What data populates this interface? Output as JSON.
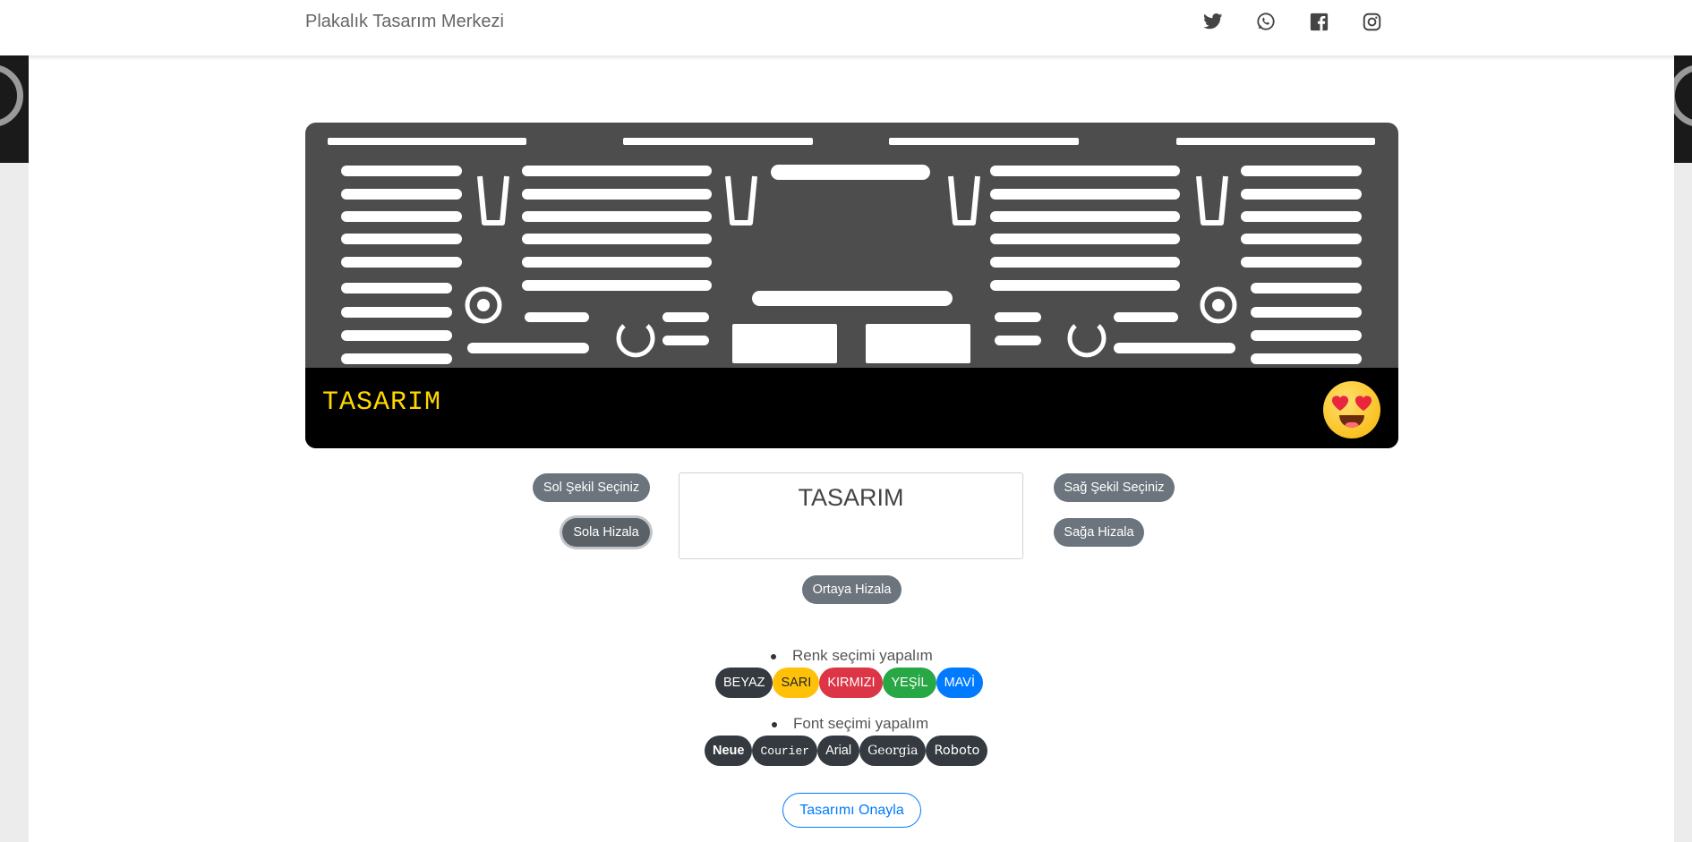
{
  "nav": {
    "brand": "Plakalık Tasarım Merkezi",
    "social": [
      "twitter-icon",
      "whatsapp-icon",
      "facebook-icon",
      "instagram-icon"
    ]
  },
  "plate": {
    "text": "TASARIM",
    "text_color": "#ffd700",
    "frame_color": "#4d4d4d",
    "strip_color": "#000000",
    "right_shape": "heart-eyes-emoji"
  },
  "controls": {
    "left_shape_label": "Sol Şekil Seçiniz",
    "right_shape_label": "Sağ Şekil Seçiniz",
    "align_left_label": "Sola Hizala",
    "align_right_label": "Sağa Hizala",
    "align_center_label": "Ortaya Hizala",
    "text_value": "TASARIM"
  },
  "colors": {
    "title": "Renk seçimi yapalım",
    "options": [
      {
        "label": "BEYAZ",
        "bg": "#343a40",
        "fg": "#ffffff"
      },
      {
        "label": "SARI",
        "bg": "#ffc107",
        "fg": "#212529"
      },
      {
        "label": "KIRMIZI",
        "bg": "#dc3545",
        "fg": "#ffffff"
      },
      {
        "label": "YEŞİL",
        "bg": "#28a745",
        "fg": "#ffffff"
      },
      {
        "label": "MAVİ",
        "bg": "#007bff",
        "fg": "#ffffff"
      }
    ]
  },
  "fonts": {
    "title": "Font seçimi yapalım",
    "options": [
      "Neue",
      "Courier",
      "Arial",
      "Georgia",
      "Roboto"
    ]
  },
  "confirm_label": "Tasarımı Onayla"
}
